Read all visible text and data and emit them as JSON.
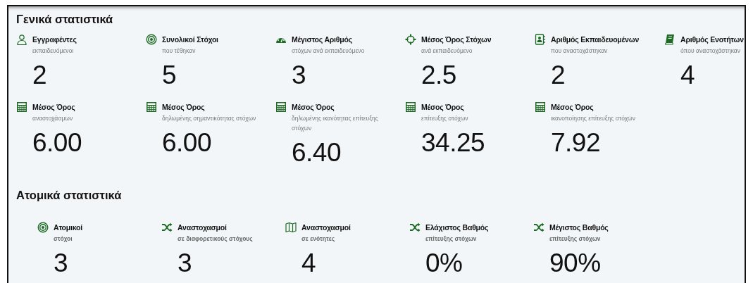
{
  "sections": [
    {
      "title": "Γενικά στατιστικά",
      "rows": [
        [
          {
            "title": "Εγγραφέντες",
            "subtitle": "εκπαιδευόμενοι",
            "value": "2"
          },
          {
            "title": "Συνολικοί Στόχοι",
            "subtitle": "που τέθηκαν",
            "value": "5"
          },
          {
            "title": "Μέγιστος Αριθμός",
            "subtitle": "στόχων ανά εκπαιδευόμενο",
            "value": "3"
          },
          {
            "title": "Μέσος Όρος Στόχων",
            "subtitle": "ανά εκπαιδευόμενο",
            "value": "2.5"
          },
          {
            "title": "Αριθμός Εκπαιδευομένων",
            "subtitle": "που αναστοχάστηκαν",
            "value": "2"
          },
          {
            "title": "Αριθμός Ενοτήτων",
            "subtitle": "όπου αναστοχάστηκαν",
            "value": "4"
          }
        ],
        [
          {
            "title": "Μέσος Όρος",
            "subtitle": "αναστοχάσμων",
            "value": "6.00"
          },
          {
            "title": "Μέσος Όρος",
            "subtitle": "δηλωμένης σημαντικότητας στόχων",
            "value": "6.00"
          },
          {
            "title": "Μέσος Όρος",
            "subtitle": "δηλωμένης ικανότητας επίτευξης στόχων",
            "value": "6.40"
          },
          {
            "title": "Μέσος Όρος",
            "subtitle": "επίτευξης στόχων",
            "value": "34.25"
          },
          {
            "title": "Μέσος Όρος",
            "subtitle": "ικανοποίησης επίτευξης στόχων",
            "value": "7.92"
          }
        ]
      ]
    },
    {
      "title": "Ατομικά στατιστικά",
      "rows": [
        [
          {
            "title": "Ατομικοί",
            "subtitle": "στόχοι",
            "value": "3"
          },
          {
            "title": "Αναστοχασμοί",
            "subtitle": "σε διαφορετικούς στόχους",
            "value": "3"
          },
          {
            "title": "Αναστοχασμοί",
            "subtitle": "σε ενότητες",
            "value": "4"
          },
          {
            "title": "Ελάχιστος Βαθμός",
            "subtitle": "επίτευξης στόχων",
            "value": "0%"
          },
          {
            "title": "Μέγιστος Βαθμός",
            "subtitle": "επίτευξης στόχων",
            "value": "90%"
          }
        ]
      ]
    }
  ]
}
